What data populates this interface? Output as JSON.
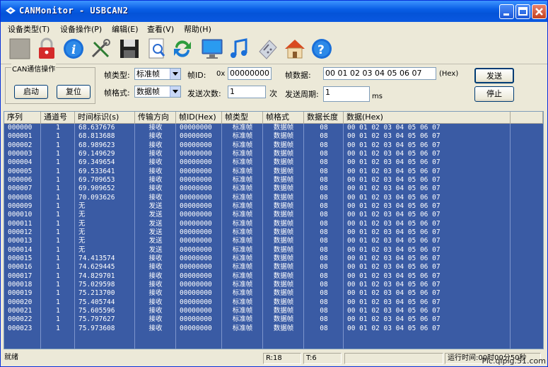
{
  "window": {
    "title": "CANMonitor - USBCAN2"
  },
  "menu": [
    "设备类型(T)",
    "设备操作(P)",
    "编辑(E)",
    "查看(V)",
    "帮助(H)"
  ],
  "toolbar": {
    "icons": [
      "stop-icon",
      "lock-icon",
      "info-icon",
      "tools-icon",
      "save-icon",
      "search-icon",
      "refresh-icon",
      "monitor-icon",
      "music-icon",
      "calculator-icon",
      "home-icon",
      "help-icon"
    ]
  },
  "can_panel": {
    "group_title": "CAN通信操作",
    "start_label": "启动",
    "reset_label": "复位",
    "frame_type_label": "帧类型:",
    "frame_type_value": "标准帧",
    "frame_format_label": "帧格式:",
    "frame_format_value": "数据帧",
    "frame_id_label": "帧ID:",
    "frame_id_prefix": "0x",
    "frame_id_value": "00000000",
    "send_count_label": "发送次数:",
    "send_count_value": "1",
    "send_count_unit": "次",
    "frame_data_label": "帧数据:",
    "frame_data_value": "00 01 02 03 04 05 06 07",
    "frame_data_unit": "(Hex)",
    "send_period_label": "发送周期:",
    "send_period_value": "1",
    "send_period_unit": "ms",
    "send_label": "发送",
    "stop_label": "停止"
  },
  "table": {
    "columns": [
      "序列",
      "通道号",
      "时间标识(s)",
      "传输方向",
      "帧ID(Hex)",
      "帧类型",
      "帧格式",
      "数据长度",
      "数据(Hex)"
    ],
    "rows": [
      [
        "000000",
        "1",
        "68.637676",
        "接收",
        "00000000",
        "标准帧",
        "数据帧",
        "08",
        "00 01 02 03 04 05 06 07"
      ],
      [
        "000001",
        "1",
        "68.813688",
        "接收",
        "00000000",
        "标准帧",
        "数据帧",
        "08",
        "00 01 02 03 04 05 06 07"
      ],
      [
        "000002",
        "1",
        "68.989623",
        "接收",
        "00000000",
        "标准帧",
        "数据帧",
        "08",
        "00 01 02 03 04 05 06 07"
      ],
      [
        "000003",
        "1",
        "69.149629",
        "接收",
        "00000000",
        "标准帧",
        "数据帧",
        "08",
        "00 01 02 03 04 05 06 07"
      ],
      [
        "000004",
        "1",
        "69.349654",
        "接收",
        "00000000",
        "标准帧",
        "数据帧",
        "08",
        "00 01 02 03 04 05 06 07"
      ],
      [
        "000005",
        "1",
        "69.533641",
        "接收",
        "00000000",
        "标准帧",
        "数据帧",
        "08",
        "00 01 02 03 04 05 06 07"
      ],
      [
        "000006",
        "1",
        "69.709653",
        "接收",
        "00000000",
        "标准帧",
        "数据帧",
        "08",
        "00 01 02 03 04 05 06 07"
      ],
      [
        "000007",
        "1",
        "69.909652",
        "接收",
        "00000000",
        "标准帧",
        "数据帧",
        "08",
        "00 01 02 03 04 05 06 07"
      ],
      [
        "000008",
        "1",
        "70.093626",
        "接收",
        "00000000",
        "标准帧",
        "数据帧",
        "08",
        "00 01 02 03 04 05 06 07"
      ],
      [
        "000009",
        "1",
        "无",
        "发送",
        "00000000",
        "标准帧",
        "数据帧",
        "08",
        "00 01 02 03 04 05 06 07"
      ],
      [
        "000010",
        "1",
        "无",
        "发送",
        "00000000",
        "标准帧",
        "数据帧",
        "08",
        "00 01 02 03 04 05 06 07"
      ],
      [
        "000011",
        "1",
        "无",
        "发送",
        "00000000",
        "标准帧",
        "数据帧",
        "08",
        "00 01 02 03 04 05 06 07"
      ],
      [
        "000012",
        "1",
        "无",
        "发送",
        "00000000",
        "标准帧",
        "数据帧",
        "08",
        "00 01 02 03 04 05 06 07"
      ],
      [
        "000013",
        "1",
        "无",
        "发送",
        "00000000",
        "标准帧",
        "数据帧",
        "08",
        "00 01 02 03 04 05 06 07"
      ],
      [
        "000014",
        "1",
        "无",
        "发送",
        "00000000",
        "标准帧",
        "数据帧",
        "08",
        "00 01 02 03 04 05 06 07"
      ],
      [
        "000015",
        "1",
        "74.413574",
        "接收",
        "00000000",
        "标准帧",
        "数据帧",
        "08",
        "00 01 02 03 04 05 06 07"
      ],
      [
        "000016",
        "1",
        "74.629445",
        "接收",
        "00000000",
        "标准帧",
        "数据帧",
        "08",
        "00 01 02 03 04 05 06 07"
      ],
      [
        "000017",
        "1",
        "74.829701",
        "接收",
        "00000000",
        "标准帧",
        "数据帧",
        "08",
        "00 01 02 03 04 05 06 07"
      ],
      [
        "000018",
        "1",
        "75.029598",
        "接收",
        "00000000",
        "标准帧",
        "数据帧",
        "08",
        "00 01 02 03 04 05 06 07"
      ],
      [
        "000019",
        "1",
        "75.213700",
        "接收",
        "00000000",
        "标准帧",
        "数据帧",
        "08",
        "00 01 02 03 04 05 06 07"
      ],
      [
        "000020",
        "1",
        "75.405744",
        "接收",
        "00000000",
        "标准帧",
        "数据帧",
        "08",
        "00 01 02 03 04 05 06 07"
      ],
      [
        "000021",
        "1",
        "75.605596",
        "接收",
        "00000000",
        "标准帧",
        "数据帧",
        "08",
        "00 01 02 03 04 05 06 07"
      ],
      [
        "000022",
        "1",
        "75.797627",
        "接收",
        "00000000",
        "标准帧",
        "数据帧",
        "08",
        "00 01 02 03 04 05 06 07"
      ],
      [
        "000023",
        "1",
        "75.973608",
        "接收",
        "00000000",
        "标准帧",
        "数据帧",
        "08",
        "00 01 02 03 04 05 06 07"
      ]
    ]
  },
  "status": {
    "state": "就绪",
    "rx": "R:18",
    "tx": "T:6",
    "runtime": "运行时间:00时00分50秒"
  },
  "watermark": "Pic.qipig.51.com",
  "colors": {
    "selection": "#3a5ba4",
    "title_blue": "#0453d8"
  }
}
